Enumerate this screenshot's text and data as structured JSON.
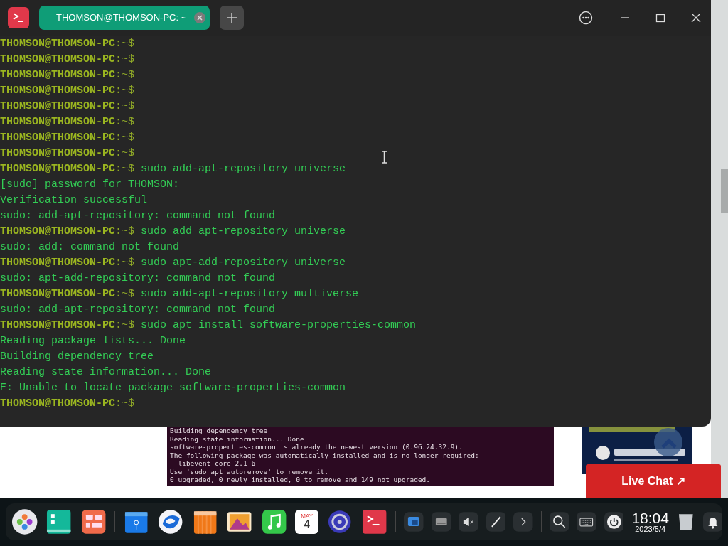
{
  "terminal": {
    "tab": {
      "title": "THOMSON@THOMSON-PC: ~",
      "selected": true
    },
    "lines": [
      {
        "kind": "prompt",
        "user": "THOMSON@THOMSON-PC",
        "suffix": ":~$"
      },
      {
        "kind": "prompt",
        "user": "THOMSON@THOMSON-PC",
        "suffix": ":~$"
      },
      {
        "kind": "prompt",
        "user": "THOMSON@THOMSON-PC",
        "suffix": ":~$"
      },
      {
        "kind": "prompt",
        "user": "THOMSON@THOMSON-PC",
        "suffix": ":~$"
      },
      {
        "kind": "prompt",
        "user": "THOMSON@THOMSON-PC",
        "suffix": ":~$"
      },
      {
        "kind": "prompt",
        "user": "THOMSON@THOMSON-PC",
        "suffix": ":~$"
      },
      {
        "kind": "prompt",
        "user": "THOMSON@THOMSON-PC",
        "suffix": ":~$"
      },
      {
        "kind": "prompt",
        "user": "THOMSON@THOMSON-PC",
        "suffix": ":~$"
      },
      {
        "kind": "prompt",
        "user": "THOMSON@THOMSON-PC",
        "suffix": ":~$",
        "text": "sudo add-apt-repository universe"
      },
      {
        "kind": "output",
        "text": "[sudo] password for THOMSON:"
      },
      {
        "kind": "output",
        "text": "Verification successful"
      },
      {
        "kind": "output",
        "text": "sudo: add-apt-repository: command not found"
      },
      {
        "kind": "prompt",
        "user": "THOMSON@THOMSON-PC",
        "suffix": ":~$",
        "text": "sudo add apt-repository universe"
      },
      {
        "kind": "output",
        "text": "sudo: add: command not found"
      },
      {
        "kind": "prompt",
        "user": "THOMSON@THOMSON-PC",
        "suffix": ":~$",
        "text": "sudo apt-add-repository universe"
      },
      {
        "kind": "output",
        "text": "sudo: apt-add-repository: command not found"
      },
      {
        "kind": "prompt",
        "user": "THOMSON@THOMSON-PC",
        "suffix": ":~$",
        "text": "sudo add-apt-repository multiverse"
      },
      {
        "kind": "output",
        "text": "sudo: add-apt-repository: command not found"
      },
      {
        "kind": "prompt",
        "user": "THOMSON@THOMSON-PC",
        "suffix": ":~$",
        "text": "sudo apt install software-properties-common"
      },
      {
        "kind": "output",
        "text": "Reading package lists... Done"
      },
      {
        "kind": "output",
        "text": "Building dependency tree"
      },
      {
        "kind": "output",
        "text": "Reading state information... Done"
      },
      {
        "kind": "output",
        "text": "E: Unable to locate package software-properties-common"
      },
      {
        "kind": "prompt",
        "user": "THOMSON@THOMSON-PC",
        "suffix": ":~$"
      }
    ]
  },
  "web_page": {
    "screenshot_lines": [
      "Building dependency tree",
      "Reading state information... Done",
      "software-properties-common is already the newest version (0.96.24.32.9).",
      "The following package was automatically installed and is no longer required:",
      "  libevent-core-2.1-6",
      "Use 'sudo apt autoremove' to remove it.",
      "0 upgraded, 0 newly installed, 0 to remove and 149 not upgraded."
    ],
    "live_chat": "Live Chat ↗"
  },
  "dock": {
    "calendar": {
      "month": "MAY",
      "day": "4"
    },
    "clock": {
      "time": "18:04",
      "date": "2023/5/4"
    }
  }
}
